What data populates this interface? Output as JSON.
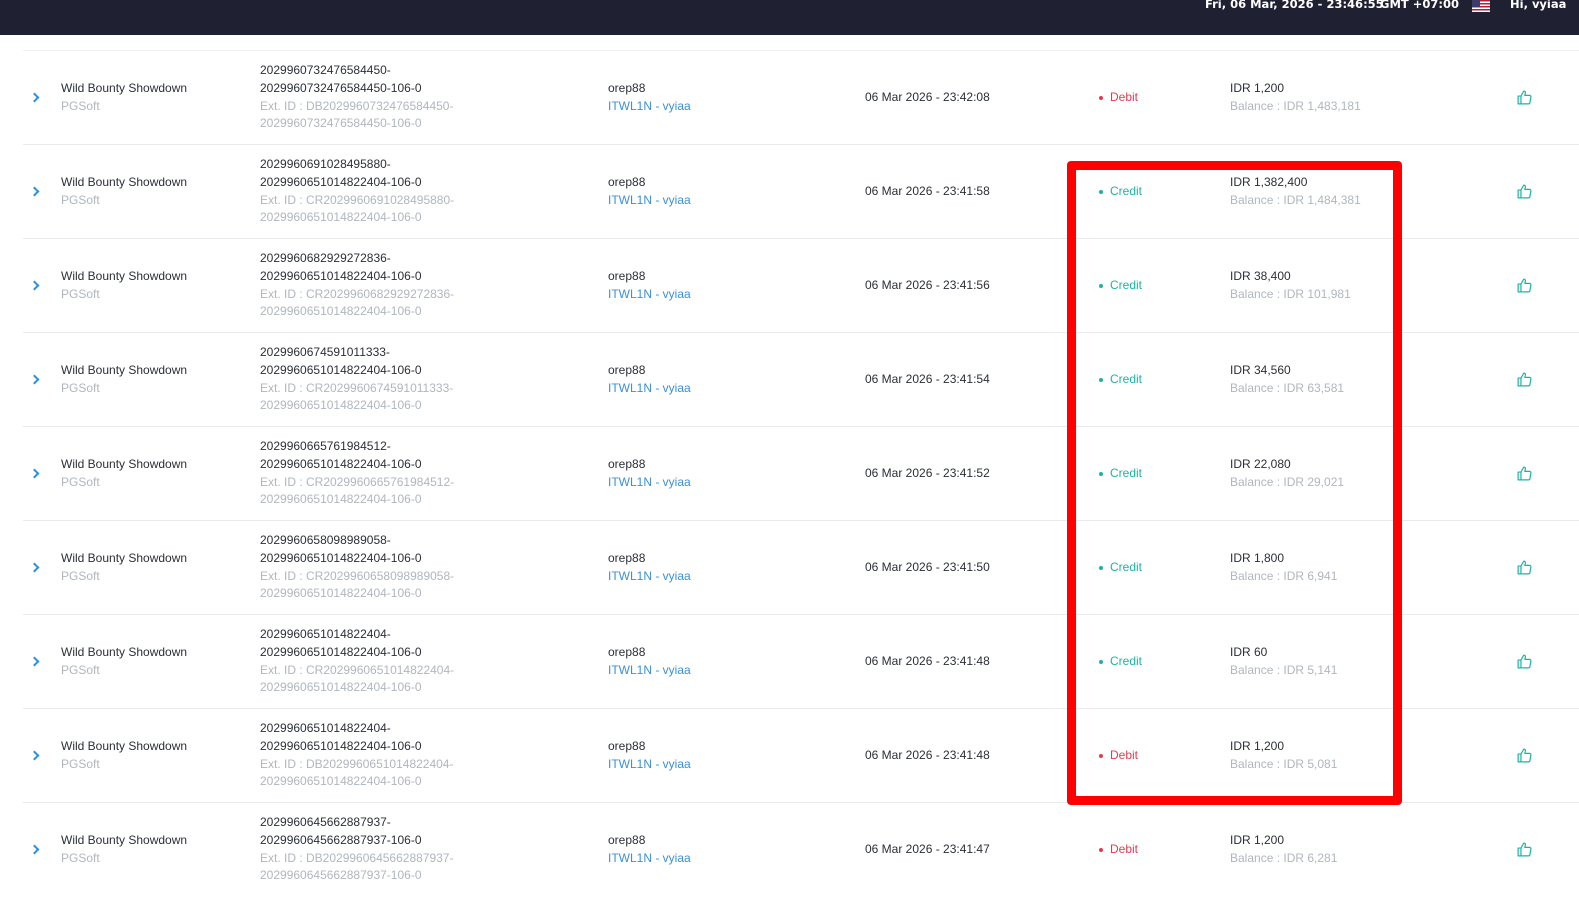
{
  "header": {
    "datetime": "Fri, 06 Mar, 2026 - 23:46:55",
    "timezone": "GMT +07:00",
    "greeting": "Hi, vyiaa",
    "flag_icon": "us-flag-icon"
  },
  "colors": {
    "topbar_bg": "#1f2032",
    "debit": "#e33b4c",
    "credit": "#1cb3a6",
    "link": "#3a90d8",
    "highlight": "#ff0000"
  },
  "rows": [
    {
      "game": "Wild Bounty Showdown",
      "provider": "PGSoft",
      "tx_line1": "2029960732476584450-",
      "tx_line2": "2029960732476584450-106-0",
      "ext_line1": "Ext. ID : DB2029960732476584450-",
      "ext_line2": "2029960732476584450-106-0",
      "player": "orep88",
      "agent": "ITWL1N - vyiaa",
      "date": "06 Mar 2026 - 23:42:08",
      "type": "Debit",
      "type_class": "debit",
      "amount": "IDR 1,200",
      "balance": "Balance : IDR 1,483,181"
    },
    {
      "game": "Wild Bounty Showdown",
      "provider": "PGSoft",
      "tx_line1": "2029960691028495880-",
      "tx_line2": "2029960651014822404-106-0",
      "ext_line1": "Ext. ID : CR2029960691028495880-",
      "ext_line2": "2029960651014822404-106-0",
      "player": "orep88",
      "agent": "ITWL1N - vyiaa",
      "date": "06 Mar 2026 - 23:41:58",
      "type": "Credit",
      "type_class": "credit",
      "amount": "IDR 1,382,400",
      "balance": "Balance : IDR 1,484,381"
    },
    {
      "game": "Wild Bounty Showdown",
      "provider": "PGSoft",
      "tx_line1": "2029960682929272836-",
      "tx_line2": "2029960651014822404-106-0",
      "ext_line1": "Ext. ID : CR2029960682929272836-",
      "ext_line2": "2029960651014822404-106-0",
      "player": "orep88",
      "agent": "ITWL1N - vyiaa",
      "date": "06 Mar 2026 - 23:41:56",
      "type": "Credit",
      "type_class": "credit",
      "amount": "IDR 38,400",
      "balance": "Balance : IDR 101,981"
    },
    {
      "game": "Wild Bounty Showdown",
      "provider": "PGSoft",
      "tx_line1": "2029960674591011333-",
      "tx_line2": "2029960651014822404-106-0",
      "ext_line1": "Ext. ID : CR2029960674591011333-",
      "ext_line2": "2029960651014822404-106-0",
      "player": "orep88",
      "agent": "ITWL1N - vyiaa",
      "date": "06 Mar 2026 - 23:41:54",
      "type": "Credit",
      "type_class": "credit",
      "amount": "IDR 34,560",
      "balance": "Balance : IDR 63,581"
    },
    {
      "game": "Wild Bounty Showdown",
      "provider": "PGSoft",
      "tx_line1": "2029960665761984512-",
      "tx_line2": "2029960651014822404-106-0",
      "ext_line1": "Ext. ID : CR2029960665761984512-",
      "ext_line2": "2029960651014822404-106-0",
      "player": "orep88",
      "agent": "ITWL1N - vyiaa",
      "date": "06 Mar 2026 - 23:41:52",
      "type": "Credit",
      "type_class": "credit",
      "amount": "IDR 22,080",
      "balance": "Balance : IDR 29,021"
    },
    {
      "game": "Wild Bounty Showdown",
      "provider": "PGSoft",
      "tx_line1": "2029960658098989058-",
      "tx_line2": "2029960651014822404-106-0",
      "ext_line1": "Ext. ID : CR2029960658098989058-",
      "ext_line2": "2029960651014822404-106-0",
      "player": "orep88",
      "agent": "ITWL1N - vyiaa",
      "date": "06 Mar 2026 - 23:41:50",
      "type": "Credit",
      "type_class": "credit",
      "amount": "IDR 1,800",
      "balance": "Balance : IDR 6,941"
    },
    {
      "game": "Wild Bounty Showdown",
      "provider": "PGSoft",
      "tx_line1": "2029960651014822404-",
      "tx_line2": "2029960651014822404-106-0",
      "ext_line1": "Ext. ID : CR2029960651014822404-",
      "ext_line2": "2029960651014822404-106-0",
      "player": "orep88",
      "agent": "ITWL1N - vyiaa",
      "date": "06 Mar 2026 - 23:41:48",
      "type": "Credit",
      "type_class": "credit",
      "amount": "IDR 60",
      "balance": "Balance : IDR 5,141"
    },
    {
      "game": "Wild Bounty Showdown",
      "provider": "PGSoft",
      "tx_line1": "2029960651014822404-",
      "tx_line2": "2029960651014822404-106-0",
      "ext_line1": "Ext. ID : DB2029960651014822404-",
      "ext_line2": "2029960651014822404-106-0",
      "player": "orep88",
      "agent": "ITWL1N - vyiaa",
      "date": "06 Mar 2026 - 23:41:48",
      "type": "Debit",
      "type_class": "debit",
      "amount": "IDR 1,200",
      "balance": "Balance : IDR 5,081"
    },
    {
      "game": "Wild Bounty Showdown",
      "provider": "PGSoft",
      "tx_line1": "2029960645662887937-",
      "tx_line2": "2029960645662887937-106-0",
      "ext_line1": "Ext. ID : DB2029960645662887937-",
      "ext_line2": "2029960645662887937-106-0",
      "player": "orep88",
      "agent": "ITWL1N - vyiaa",
      "date": "06 Mar 2026 - 23:41:47",
      "type": "Debit",
      "type_class": "debit",
      "amount": "IDR 1,200",
      "balance": "Balance : IDR 6,281"
    }
  ]
}
